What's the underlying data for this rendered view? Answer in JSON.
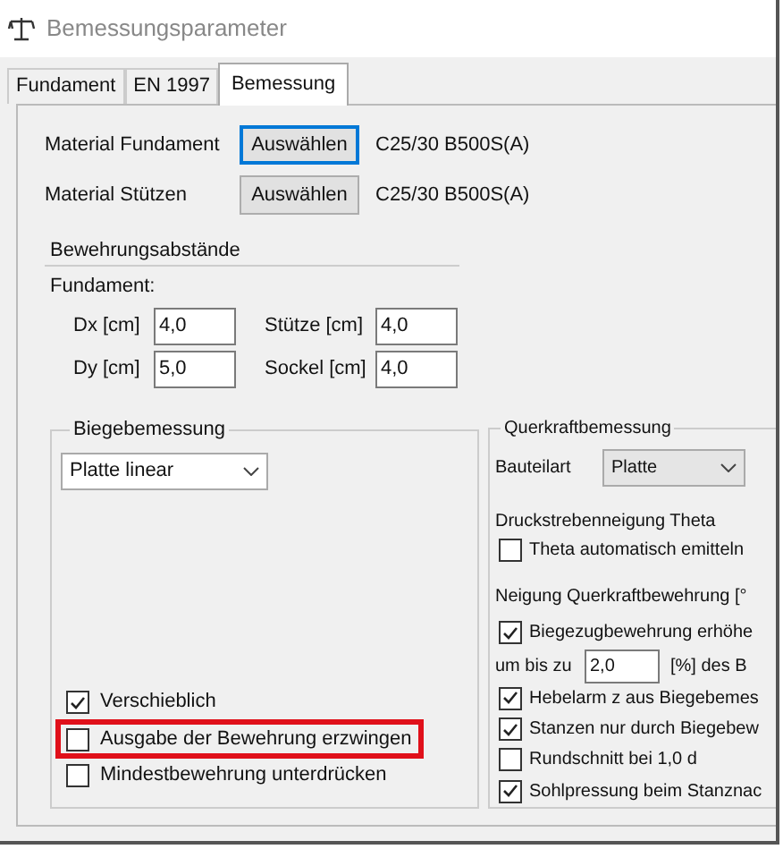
{
  "window": {
    "title": "Bemessungsparameter"
  },
  "tabs": [
    {
      "label": "Fundament",
      "selected": false
    },
    {
      "label": "EN 1997",
      "selected": false
    },
    {
      "label": "Bemessung",
      "selected": true
    }
  ],
  "materials": [
    {
      "label": "Material Fundament",
      "button": "Auswählen",
      "focused": true,
      "value": "C25/30 B500S(A)"
    },
    {
      "label": "Material Stützen",
      "button": "Auswählen",
      "focused": false,
      "value": "C25/30 B500S(A)"
    }
  ],
  "spacing": {
    "title": "Bewehrungsabstände",
    "subtitle": "Fundament:",
    "fields": [
      {
        "label": "Dx [cm]",
        "value": "4,0"
      },
      {
        "label": "Stütze [cm]",
        "value": "4,0"
      },
      {
        "label": "Dy [cm]",
        "value": "5,0"
      },
      {
        "label": "Sockel [cm]",
        "value": "4,0"
      }
    ]
  },
  "bending": {
    "title": "Biegebemessung",
    "dropdown": "Platte linear",
    "options": [
      {
        "label": "Verschieblich",
        "checked": true,
        "highlighted": false
      },
      {
        "label": "Ausgabe der Bewehrung erzwingen",
        "checked": false,
        "highlighted": true
      },
      {
        "label": "Mindestbewehrung unterdrücken",
        "checked": false,
        "highlighted": false
      }
    ]
  },
  "shear": {
    "title": "Querkraftbemessung",
    "component_label": "Bauteilart",
    "component_value": "Platte",
    "items": [
      {
        "kind": "heading",
        "label": "Druckstrebenneigung Theta"
      },
      {
        "kind": "checkbox",
        "label": "Theta automatisch emitteln",
        "checked": false
      },
      {
        "kind": "heading",
        "label": "Neigung Querkraftbewehrung [°"
      },
      {
        "kind": "checkbox",
        "label": "Biegezugbewehrung erhöhe",
        "checked": true
      },
      {
        "kind": "input",
        "label": "um bis zu",
        "value": "2,0",
        "suffix": "[%] des B"
      },
      {
        "kind": "checkbox",
        "label": "Hebelarm z aus Biegebemes",
        "checked": true
      },
      {
        "kind": "checkbox",
        "label": "Stanzen nur durch Biegebew",
        "checked": true
      },
      {
        "kind": "checkbox",
        "label": "Rundschnitt bei 1,0 d",
        "checked": false
      },
      {
        "kind": "checkbox",
        "label": "Sohlpressung beim Stanznac",
        "checked": true
      }
    ]
  }
}
